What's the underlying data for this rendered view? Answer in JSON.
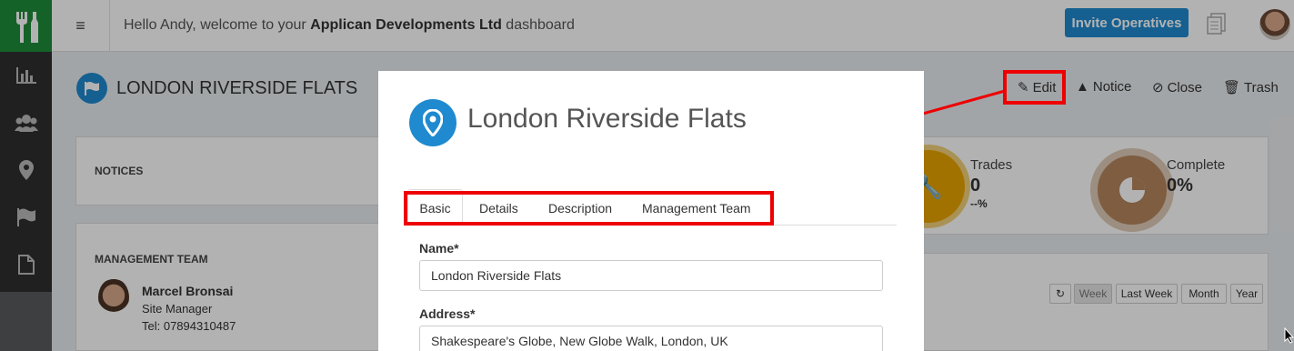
{
  "header": {
    "welcome_prefix": "Hello Andy, welcome to your ",
    "company": "Applican Developments Ltd",
    "welcome_suffix": " dashboard",
    "invite_label": "Invite Operatives"
  },
  "sidebar": {
    "icons": [
      "chart-icon",
      "users-icon",
      "map-marker-icon",
      "flag-icon",
      "document-icon"
    ]
  },
  "project": {
    "title": "LONDON RIVERSIDE FLATS",
    "actions": {
      "edit": "Edit",
      "notice": "Notice",
      "close": "Close",
      "trash": "Trash"
    }
  },
  "notices": {
    "heading": "NOTICES"
  },
  "management": {
    "heading": "MANAGEMENT TEAM",
    "person": {
      "name": "Marcel Bronsai",
      "role": "Site Manager",
      "phone": "Tel: 07894310487"
    }
  },
  "stats": {
    "trades": {
      "label": "Trades",
      "value": "0",
      "sub": "--%"
    },
    "complete": {
      "label": "Complete",
      "value": "0%"
    }
  },
  "range": {
    "week": "Week",
    "last_week": "Last Week",
    "month": "Month",
    "year": "Year"
  },
  "modal": {
    "title": "London Riverside Flats",
    "tabs": [
      "Basic",
      "Details",
      "Description",
      "Management Team"
    ],
    "name_label": "Name*",
    "name_value": "London Riverside Flats",
    "address_label": "Address*",
    "address_value": "Shakespeare's Globe, New Globe Walk, London, UK"
  },
  "colors": {
    "accent_blue": "#1f8ad0",
    "brand_green": "#1f8d3a",
    "highlight_red": "#ee0000",
    "trades_gold": "#e9a400",
    "complete_tan": "#b5865e"
  }
}
